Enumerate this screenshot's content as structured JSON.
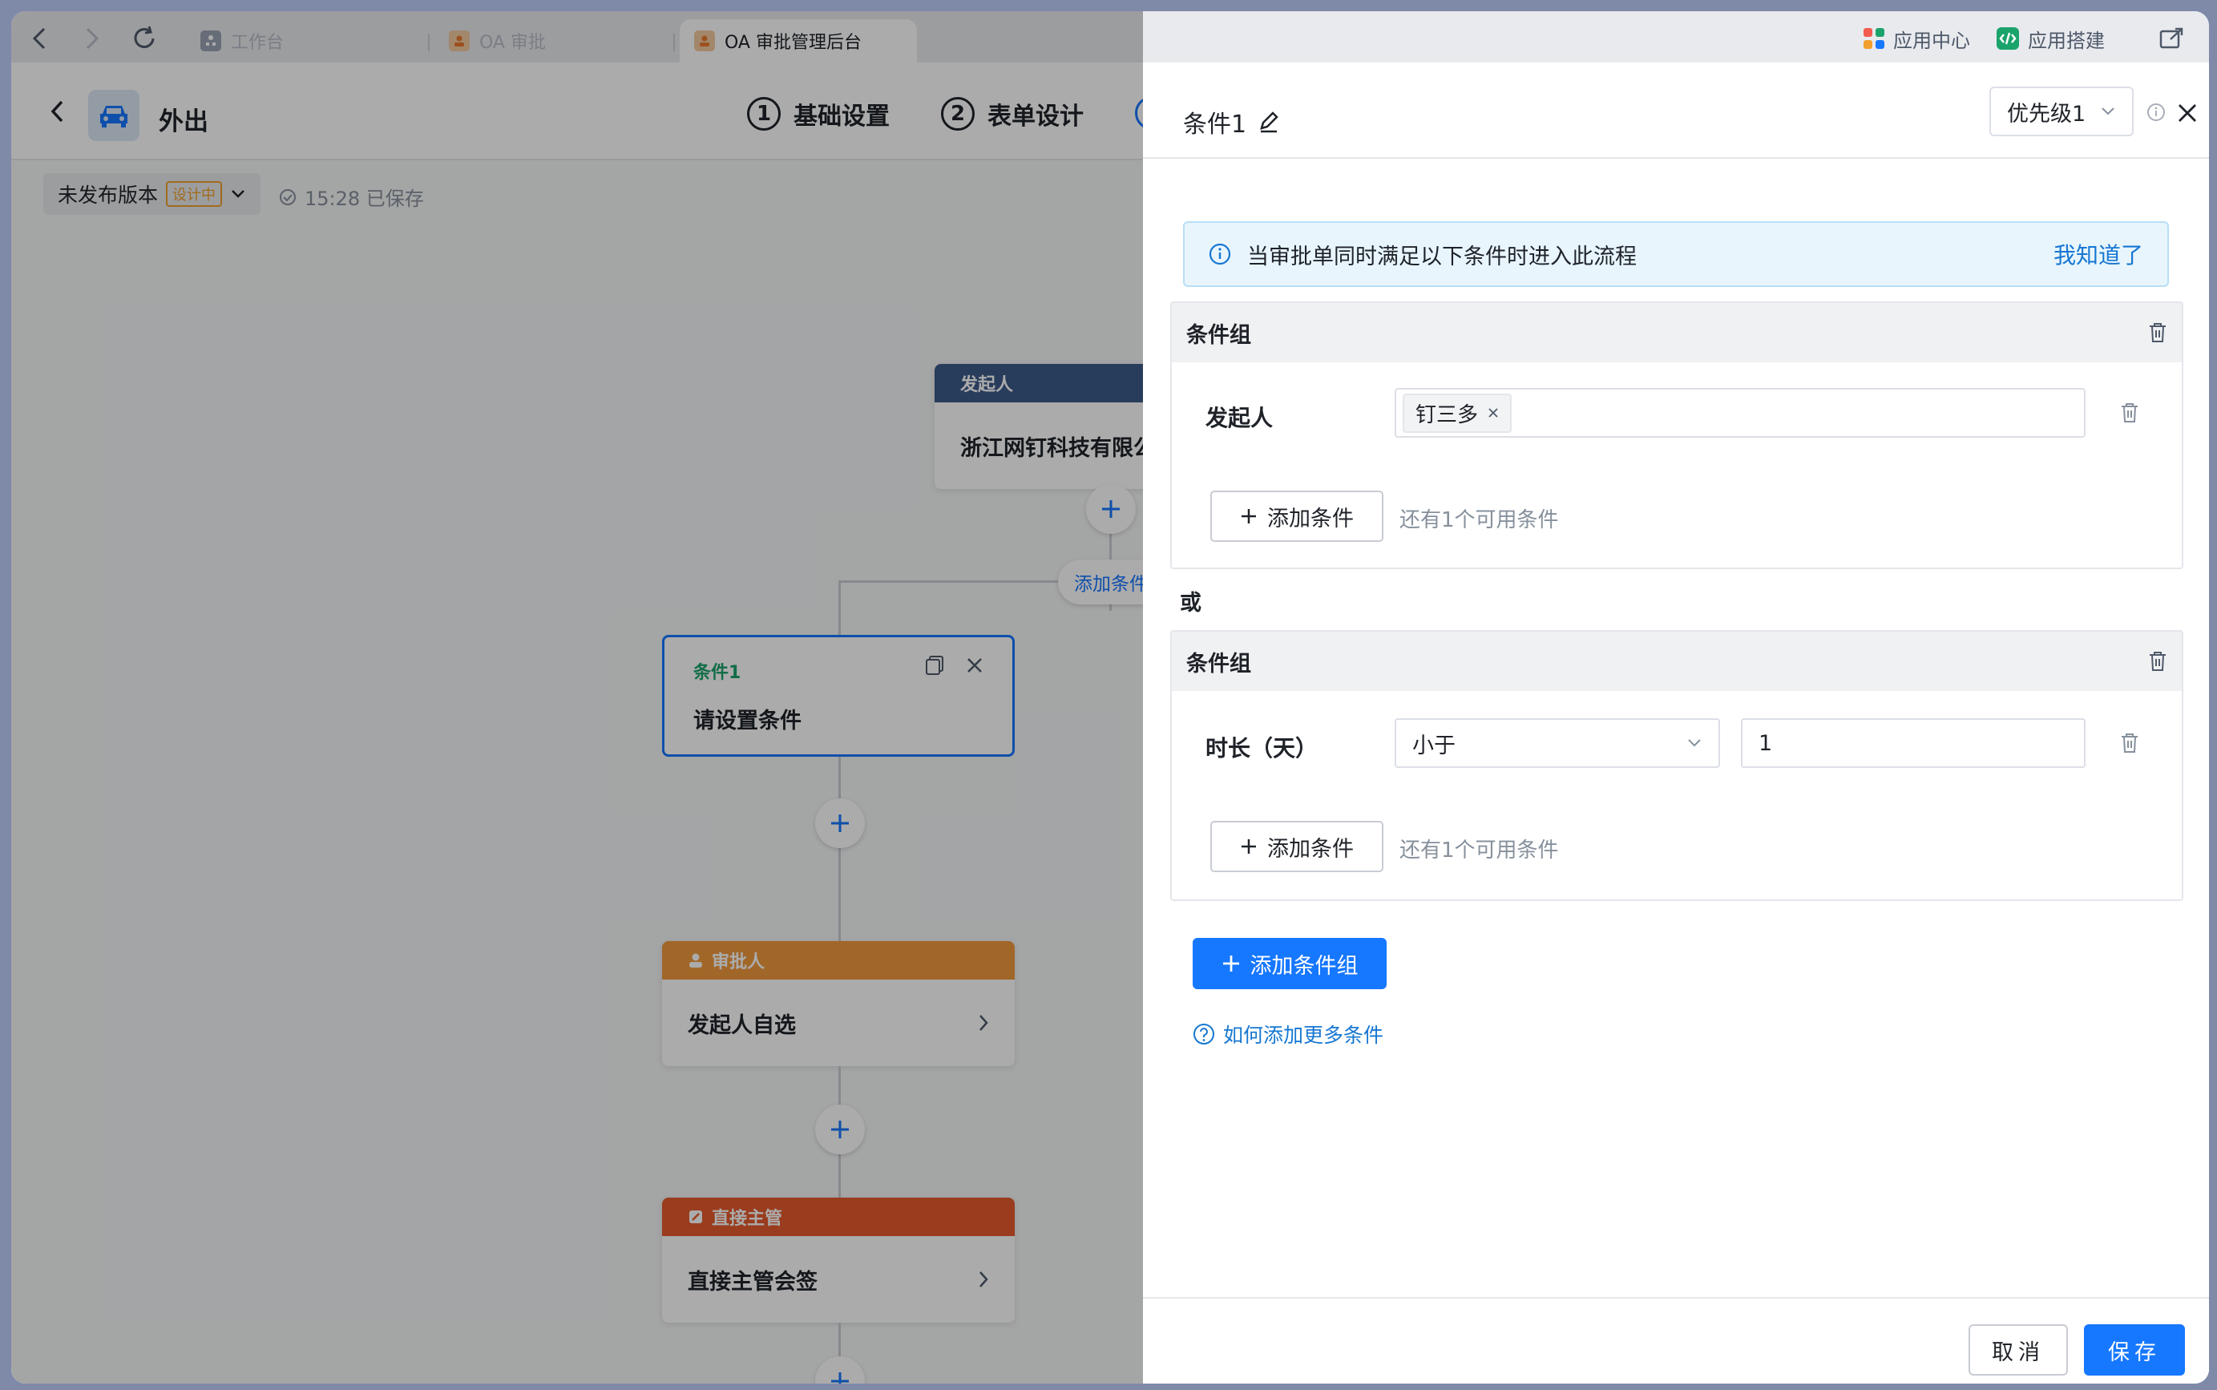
{
  "browser": {
    "tabs": [
      {
        "label": "工作台"
      },
      {
        "label": "OA 审批"
      },
      {
        "label": "OA 审批管理后台"
      }
    ],
    "app_center": "应用中心",
    "app_builder": "应用搭建"
  },
  "app": {
    "title": "外出",
    "steps": [
      {
        "num": "1",
        "label": "基础设置"
      },
      {
        "num": "2",
        "label": "表单设计"
      }
    ],
    "version": "未发布版本",
    "version_badge": "设计中",
    "saved": "15:28 已保存"
  },
  "flow": {
    "initiator_head": "发起人",
    "initiator_body": "浙江网钉科技有限公",
    "add_condition": "添加条件",
    "cond_title": "条件1",
    "cond_body": "请设置条件",
    "approver_head": "审批人",
    "approver_body": "发起人自选",
    "manager_head": "直接主管",
    "manager_body": "直接主管会签"
  },
  "drawer": {
    "title": "条件1",
    "priority": "优先级1",
    "banner": "当审批单同时满足以下条件时进入此流程",
    "banner_action": "我知道了",
    "group_title": "条件组",
    "or": "或",
    "group1": {
      "label": "发起人",
      "tag": "钉三多",
      "add_btn": "添加条件",
      "hint": "还有1个可用条件"
    },
    "group2": {
      "label": "时长（天）",
      "operator": "小于",
      "value": "1",
      "add_btn": "添加条件",
      "hint": "还有1个可用条件"
    },
    "add_group": "添加条件组",
    "help": "如何添加更多条件",
    "cancel": "取消",
    "save": "保存"
  },
  "colors": {
    "primary": "#1677ff",
    "initiator": "#3d5a8a",
    "approver": "#f09a3e",
    "manager": "#e65a2e",
    "condition": "#1aa36b"
  }
}
